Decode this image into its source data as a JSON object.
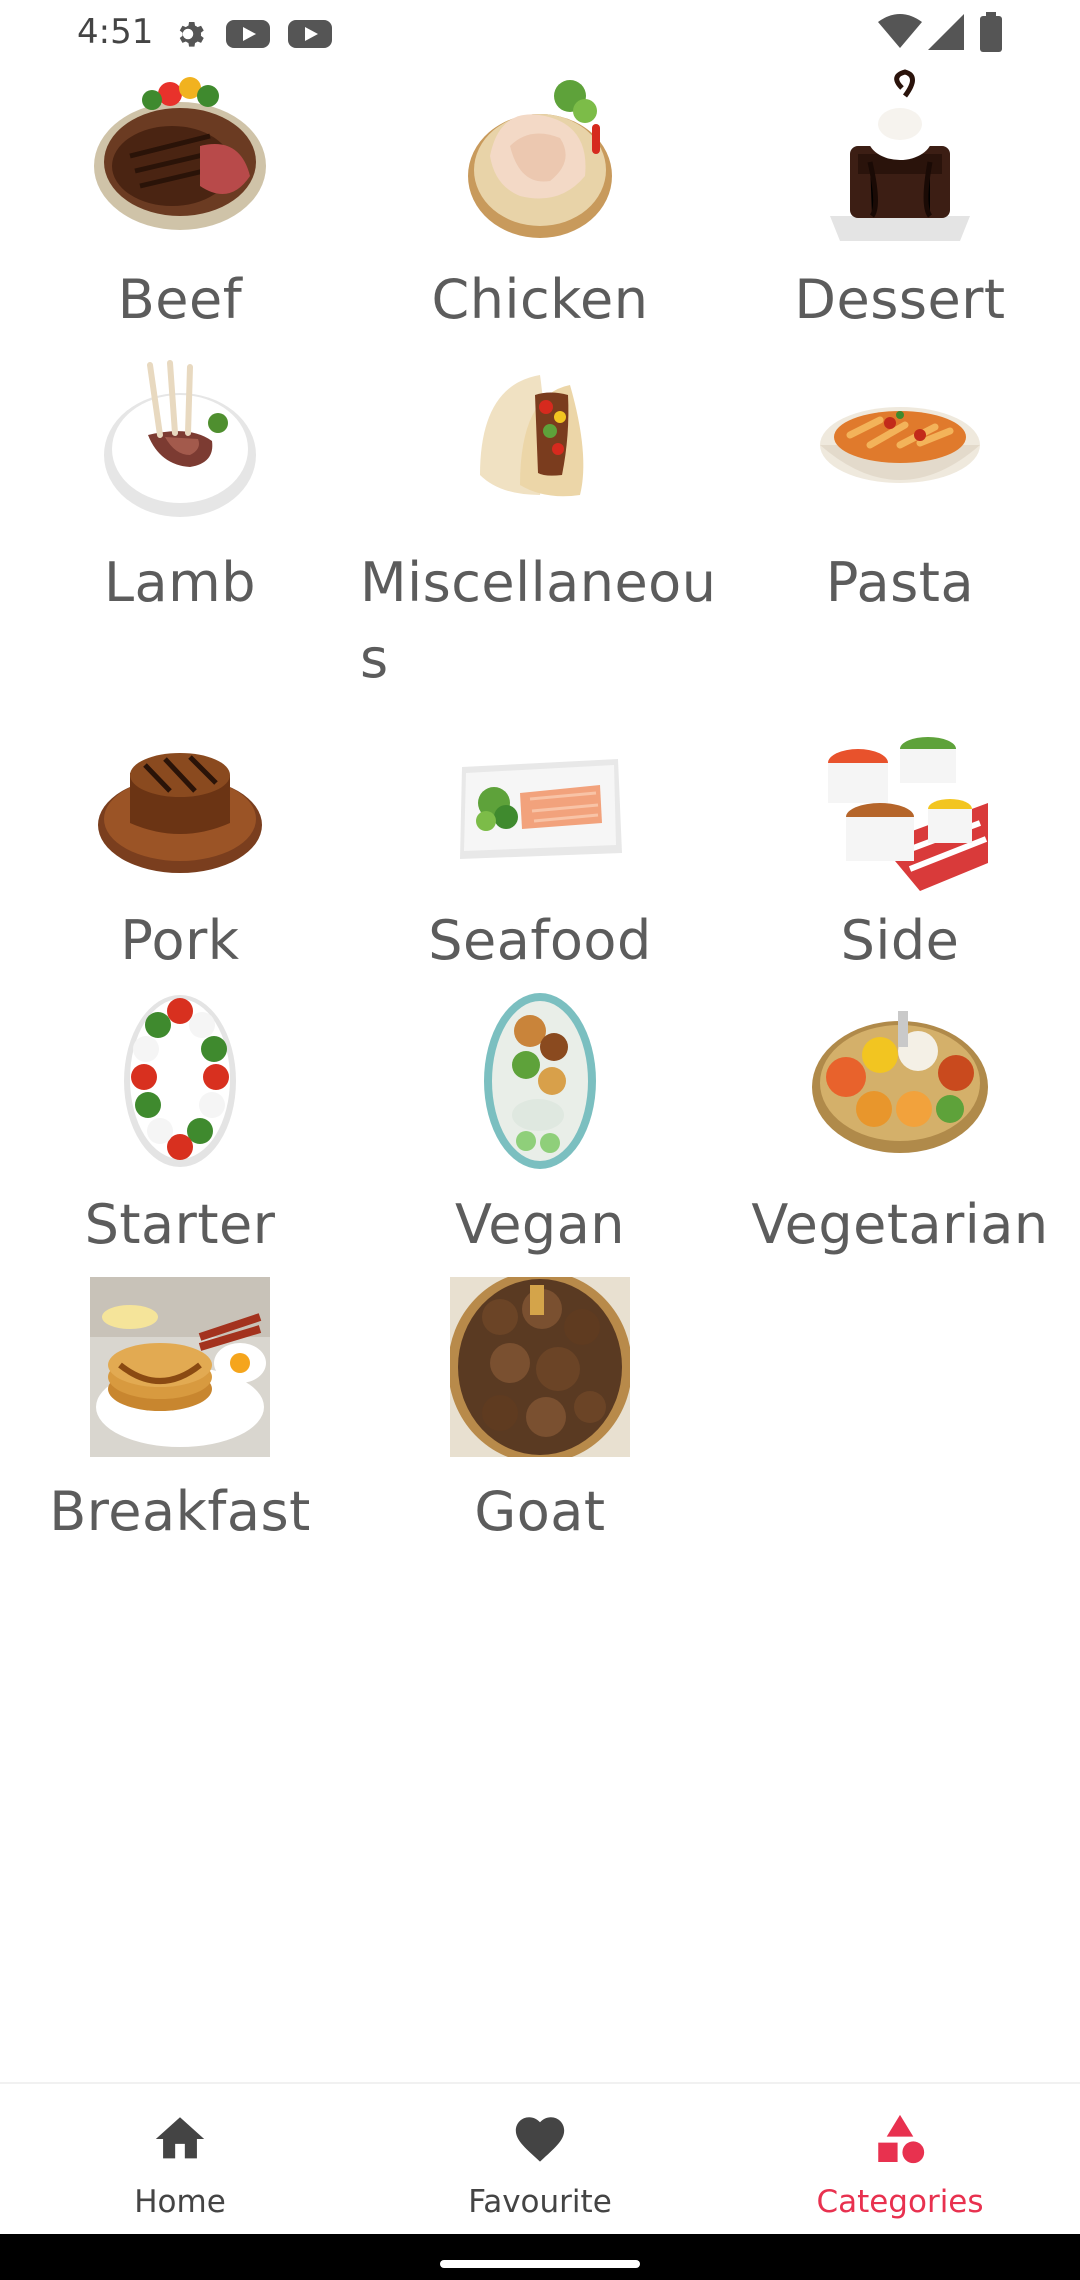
{
  "status_bar": {
    "time": "4:51",
    "left_icons": [
      "gear-icon",
      "youtube-icon",
      "youtube-icon"
    ],
    "right_icons": [
      "wifi-icon",
      "signal-icon",
      "battery-icon"
    ]
  },
  "categories": [
    {
      "label": "Beef",
      "icon": "beef-photo"
    },
    {
      "label": "Chicken",
      "icon": "chicken-photo"
    },
    {
      "label": "Dessert",
      "icon": "dessert-photo"
    },
    {
      "label": "Lamb",
      "icon": "lamb-photo"
    },
    {
      "label": "Miscellaneous",
      "icon": "miscellaneous-photo"
    },
    {
      "label": "Pasta",
      "icon": "pasta-photo"
    },
    {
      "label": "Pork",
      "icon": "pork-photo"
    },
    {
      "label": "Seafood",
      "icon": "seafood-photo"
    },
    {
      "label": "Side",
      "icon": "side-photo"
    },
    {
      "label": "Starter",
      "icon": "starter-photo"
    },
    {
      "label": "Vegan",
      "icon": "vegan-photo"
    },
    {
      "label": "Vegetarian",
      "icon": "vegetarian-photo"
    },
    {
      "label": "Breakfast",
      "icon": "breakfast-photo"
    },
    {
      "label": "Goat",
      "icon": "goat-photo"
    }
  ],
  "bottom_nav": {
    "items": [
      {
        "label": "Home",
        "icon": "home-icon",
        "active": false
      },
      {
        "label": "Favourite",
        "icon": "heart-icon",
        "active": false
      },
      {
        "label": "Categories",
        "icon": "categories-icon",
        "active": true
      }
    ],
    "active_color": "#e8314f",
    "inactive_color": "#444444"
  }
}
